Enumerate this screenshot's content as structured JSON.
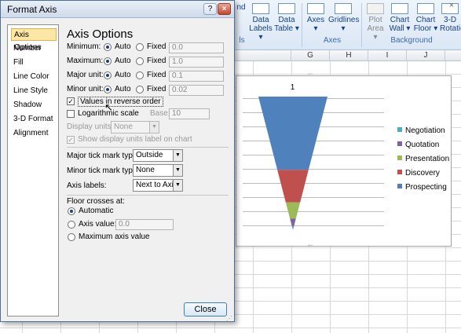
{
  "ribbon": {
    "close_glyph": "×",
    "buttons": [
      {
        "id": "lines",
        "label": "nd"
      },
      {
        "id": "data-labels",
        "label": "Data Labels ▾"
      },
      {
        "id": "data-table",
        "label": "Data Table ▾"
      },
      {
        "id": "axes",
        "label": "Axes ▾"
      },
      {
        "id": "gridlines",
        "label": "Gridlines ▾"
      },
      {
        "id": "plot-area",
        "label": "Plot Area ▾"
      },
      {
        "id": "chart-wall",
        "label": "Chart Wall ▾"
      },
      {
        "id": "chart-floor",
        "label": "Chart Floor ▾"
      },
      {
        "id": "rotation",
        "label": "3-D Rotation"
      }
    ],
    "groups": {
      "left": "ls",
      "axes": "Axes",
      "background": "Background"
    }
  },
  "sheet": {
    "columns": [
      "",
      "G",
      "H",
      "I",
      "J",
      "K"
    ]
  },
  "chart": {
    "title_value": "1",
    "legend": [
      {
        "label": "Negotiation",
        "color": "#4bacc6"
      },
      {
        "label": "Quotation",
        "color": "#8064a2"
      },
      {
        "label": "Presentation",
        "color": "#9bbb59"
      },
      {
        "label": "Discovery",
        "color": "#c0504d"
      },
      {
        "label": "Prospecting",
        "color": "#4f81bd"
      }
    ],
    "handle_glyph": "·····"
  },
  "chart_data": {
    "type": "bar",
    "categories": [
      "1"
    ],
    "series": [
      {
        "name": "Prospecting",
        "values": [
          45
        ],
        "color": "#4f81bd"
      },
      {
        "name": "Discovery",
        "values": [
          20
        ],
        "color": "#c0504d"
      },
      {
        "name": "Presentation",
        "values": [
          10
        ],
        "color": "#9bbb59"
      },
      {
        "name": "Quotation",
        "values": [
          5
        ],
        "color": "#8064a2"
      },
      {
        "name": "Negotiation",
        "values": [
          2
        ],
        "color": "#4bacc6"
      }
    ],
    "stacked": true,
    "shape": "inverted pyramid (funnel)",
    "legend_position": "right",
    "grid": true
  },
  "dialog": {
    "title": "Format Axis",
    "help_glyph": "?",
    "close_glyph": "×",
    "nav": [
      "Axis Options",
      "Number",
      "Fill",
      "Line Color",
      "Line Style",
      "Shadow",
      "3-D Format",
      "Alignment"
    ],
    "selected_nav": "Axis Options",
    "panel_title": "Axis Options",
    "bounds": [
      {
        "label": "Minimum:",
        "auto": "Auto",
        "fixed": "Fixed",
        "value": "0.0"
      },
      {
        "label": "Maximum:",
        "auto": "Auto",
        "fixed": "Fixed",
        "value": "1.0"
      },
      {
        "label": "Major unit:",
        "auto": "Auto",
        "fixed": "Fixed",
        "value": "0.1"
      },
      {
        "label": "Minor unit:",
        "auto": "Auto",
        "fixed": "Fixed",
        "value": "0.02"
      }
    ],
    "values_reverse": {
      "label": "Values in reverse order",
      "checked": true
    },
    "log_scale": {
      "label": "Logarithmic scale",
      "base_label": "Base:",
      "base_value": "10",
      "checked": false
    },
    "display_units": {
      "label": "Display units:",
      "value": "None"
    },
    "show_units_label": {
      "label": "Show display units label on chart",
      "checked": true
    },
    "major_tick": {
      "label": "Major tick mark type:",
      "value": "Outside"
    },
    "minor_tick": {
      "label": "Minor tick mark type:",
      "value": "None"
    },
    "axis_labels": {
      "label": "Axis labels:",
      "value": "Next to Axis"
    },
    "floor_crosses": {
      "heading": "Floor crosses at:",
      "options": [
        "Automatic",
        "Axis value:",
        "Maximum axis value"
      ],
      "selected": "Automatic",
      "axis_value": "0.0"
    },
    "close_button": "Close",
    "check_glyph": "✓",
    "dropdown_glyph": "▼"
  }
}
